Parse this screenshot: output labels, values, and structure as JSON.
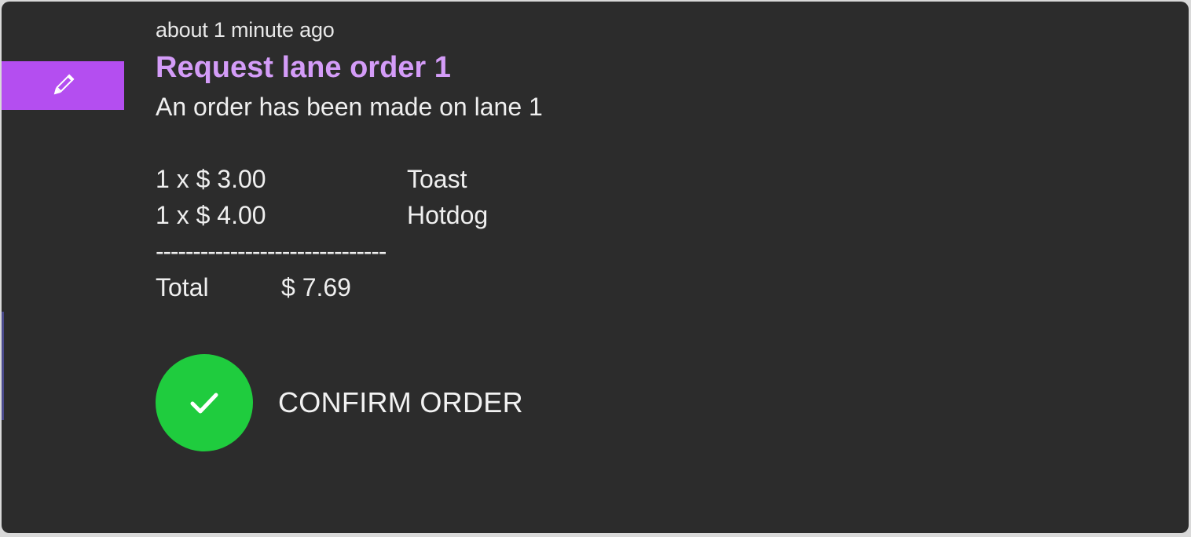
{
  "notification": {
    "timestamp": "about 1 minute ago",
    "title": "Request lane order 1",
    "message": "An order has been made on lane 1",
    "badge_icon": "pencil-icon",
    "accent_color": "#b44ef0",
    "title_color": "#d49cf8"
  },
  "order": {
    "items": [
      {
        "qty_price": "1 x $ 3.00",
        "name": "Toast"
      },
      {
        "qty_price": "1 x $ 4.00",
        "name": "Hotdog"
      }
    ],
    "divider": "-------------------------------",
    "total_label": "Total",
    "total_amount": "$ 7.69"
  },
  "actions": {
    "confirm_label": "CONFIRM ORDER",
    "confirm_icon": "checkmark-icon",
    "confirm_color": "#1fcc3e"
  }
}
